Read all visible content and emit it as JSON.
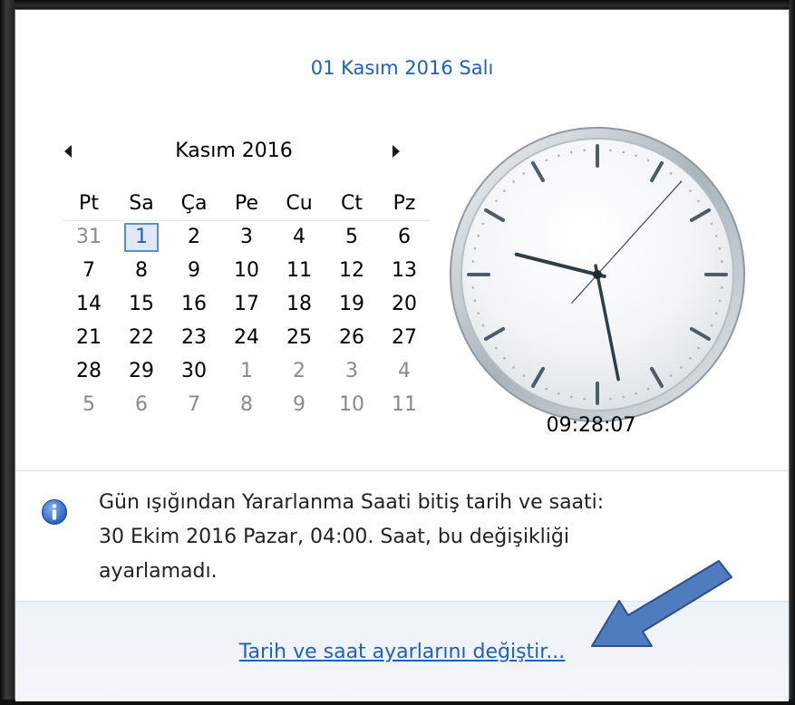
{
  "header": {
    "date_full": "01 Kasım 2016 Salı"
  },
  "calendar": {
    "month_title": "Kasım 2016",
    "prev_icon": "triangle-left-icon",
    "next_icon": "triangle-right-icon",
    "weekdays": [
      "Pt",
      "Sa",
      "Ça",
      "Pe",
      "Cu",
      "Ct",
      "Pz"
    ],
    "days": [
      {
        "d": "31",
        "muted": true
      },
      {
        "d": "1",
        "today": true
      },
      {
        "d": "2"
      },
      {
        "d": "3"
      },
      {
        "d": "4"
      },
      {
        "d": "5"
      },
      {
        "d": "6"
      },
      {
        "d": "7"
      },
      {
        "d": "8"
      },
      {
        "d": "9"
      },
      {
        "d": "10"
      },
      {
        "d": "11"
      },
      {
        "d": "12"
      },
      {
        "d": "13"
      },
      {
        "d": "14"
      },
      {
        "d": "15"
      },
      {
        "d": "16"
      },
      {
        "d": "17"
      },
      {
        "d": "18"
      },
      {
        "d": "19"
      },
      {
        "d": "20"
      },
      {
        "d": "21"
      },
      {
        "d": "22"
      },
      {
        "d": "23"
      },
      {
        "d": "24"
      },
      {
        "d": "25"
      },
      {
        "d": "26"
      },
      {
        "d": "27"
      },
      {
        "d": "28"
      },
      {
        "d": "29"
      },
      {
        "d": "30"
      },
      {
        "d": "1",
        "muted": true
      },
      {
        "d": "2",
        "muted": true
      },
      {
        "d": "3",
        "muted": true
      },
      {
        "d": "4",
        "muted": true
      },
      {
        "d": "5",
        "muted": true
      },
      {
        "d": "6",
        "muted": true
      },
      {
        "d": "7",
        "muted": true
      },
      {
        "d": "8",
        "muted": true
      },
      {
        "d": "9",
        "muted": true
      },
      {
        "d": "10",
        "muted": true
      },
      {
        "d": "11",
        "muted": true
      }
    ]
  },
  "clock": {
    "time_text": "09:28:07",
    "hour": 9,
    "minute": 28,
    "second": 7
  },
  "info": {
    "icon": "info-icon",
    "text_line1": "Gün ışığından Yararlanma Saati bitiş tarih ve saati:",
    "text_line2": "30 Ekim 2016 Pazar, 04:00. Saat, bu değişikliği",
    "text_line3": "ayarlamadı."
  },
  "footer": {
    "link_label": "Tarih ve saat ayarlarını değiştir..."
  },
  "colors": {
    "link": "#1e5fc0",
    "annotation_arrow": "#4f7bbf"
  }
}
